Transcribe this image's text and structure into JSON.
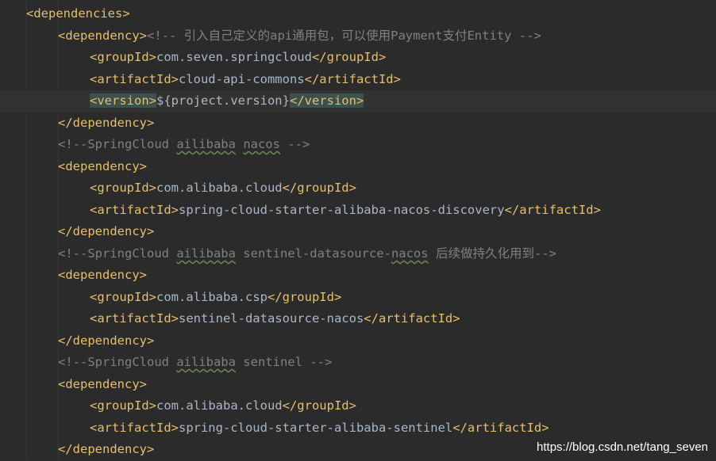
{
  "code": {
    "l1_open": "<dependencies>",
    "l2_open": "<dependency>",
    "l2_comment": "<!-- 引入自己定义的api通用包，可以使用Payment支付Entity -->",
    "l3_open": "<groupId>",
    "l3_value": "com.seven.springcloud",
    "l3_close": "</groupId>",
    "l4_open": "<artifactId>",
    "l4_value": "cloud-api-commons",
    "l4_close": "</artifactId>",
    "l5_open": "<version>",
    "l5_value": "${project.version}",
    "l5_close": "</version>",
    "l6_close": "</dependency>",
    "l7_c1": "<!--SpringCloud ",
    "l7_w1": "ailibaba",
    "l7_c2": " ",
    "l7_w2": "nacos",
    "l7_c3": " -->",
    "l8_open": "<dependency>",
    "l9_open": "<groupId>",
    "l9_value": "com.alibaba.cloud",
    "l9_close": "</groupId>",
    "l10_open": "<artifactId>",
    "l10_value": "spring-cloud-starter-alibaba-nacos-discovery",
    "l10_close": "</artifactId>",
    "l11_close": "</dependency>",
    "l12_c1": "<!--SpringCloud ",
    "l12_w1": "ailibaba",
    "l12_c2": " sentinel-datasource-",
    "l12_w2": "nacos",
    "l12_c3": " 后续做持久化用到-->",
    "l13_open": "<dependency>",
    "l14_open": "<groupId>",
    "l14_value": "com.alibaba.csp",
    "l14_close": "</groupId>",
    "l15_open": "<artifactId>",
    "l15_value": "sentinel-datasource-nacos",
    "l15_close": "</artifactId>",
    "l16_close": "</dependency>",
    "l17_c1": "<!--SpringCloud ",
    "l17_w1": "ailibaba",
    "l17_c2": " sentinel -->",
    "l18_open": "<dependency>",
    "l19_open": "<groupId>",
    "l19_value": "com.alibaba.cloud",
    "l19_close": "</groupId>",
    "l20_open": "<artifactId>",
    "l20_value": "spring-cloud-starter-alibaba-sentinel",
    "l20_close": "</artifactId>",
    "l21_close": "</dependency>"
  },
  "watermark": "https://blog.csdn.net/tang_seven",
  "colors": {
    "background": "#2b2b2b",
    "tag": "#e8bf6a",
    "text": "#a9b7c6",
    "comment": "#808080",
    "highlight": "#3b514d"
  }
}
